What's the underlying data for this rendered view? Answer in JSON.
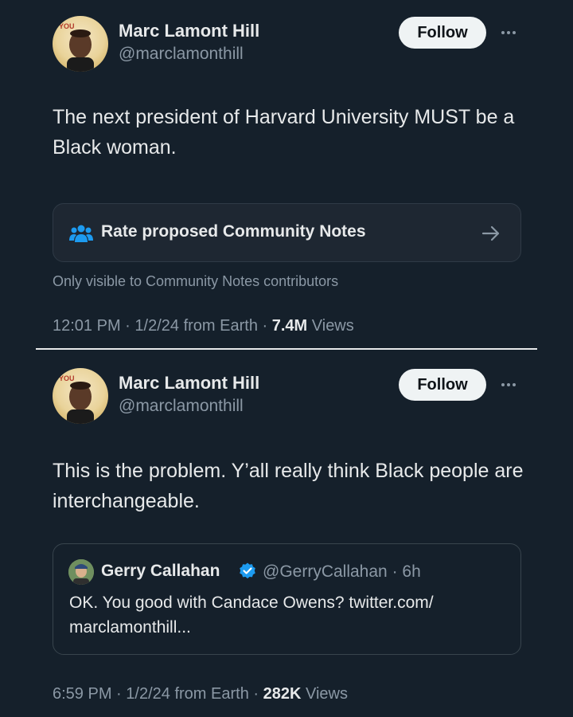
{
  "tweets": [
    {
      "author_name": "Marc Lamont Hill",
      "author_handle": "@marclamonthill",
      "follow_label": "Follow",
      "text": "The next president of Harvard University MUST be a Black woman.",
      "community_notes_label": "Rate proposed Community Notes",
      "visibility_note": "Only visible to Community Notes contributors",
      "time": "12:01 PM",
      "date": "1/2/24",
      "source": "from Earth",
      "views_count": "7.4M",
      "views_label": "Views"
    },
    {
      "author_name": "Marc Lamont Hill",
      "author_handle": "@marclamonthill",
      "follow_label": "Follow",
      "text": "This is the problem. Y’all really think Black people are interchangeable.",
      "quote": {
        "author_name": "Gerry Callahan",
        "author_handle": "@GerryCallahan",
        "age": "6h",
        "text": "OK. You good with Candace Owens? twitter.com/ marclamonthill..."
      },
      "time": "6:59 PM",
      "date": "1/2/24",
      "source": "from Earth",
      "views_count": "282K",
      "views_label": "Views"
    }
  ],
  "separator": "·",
  "icons": [
    "more-icon",
    "community-notes-icon",
    "arrow-right-icon",
    "verified-badge-icon"
  ],
  "colors": {
    "background": "#15202b",
    "verified": "#1d9bf0",
    "notes_icon": "#1d9bf0",
    "secondary_text": "#8b98a5"
  }
}
